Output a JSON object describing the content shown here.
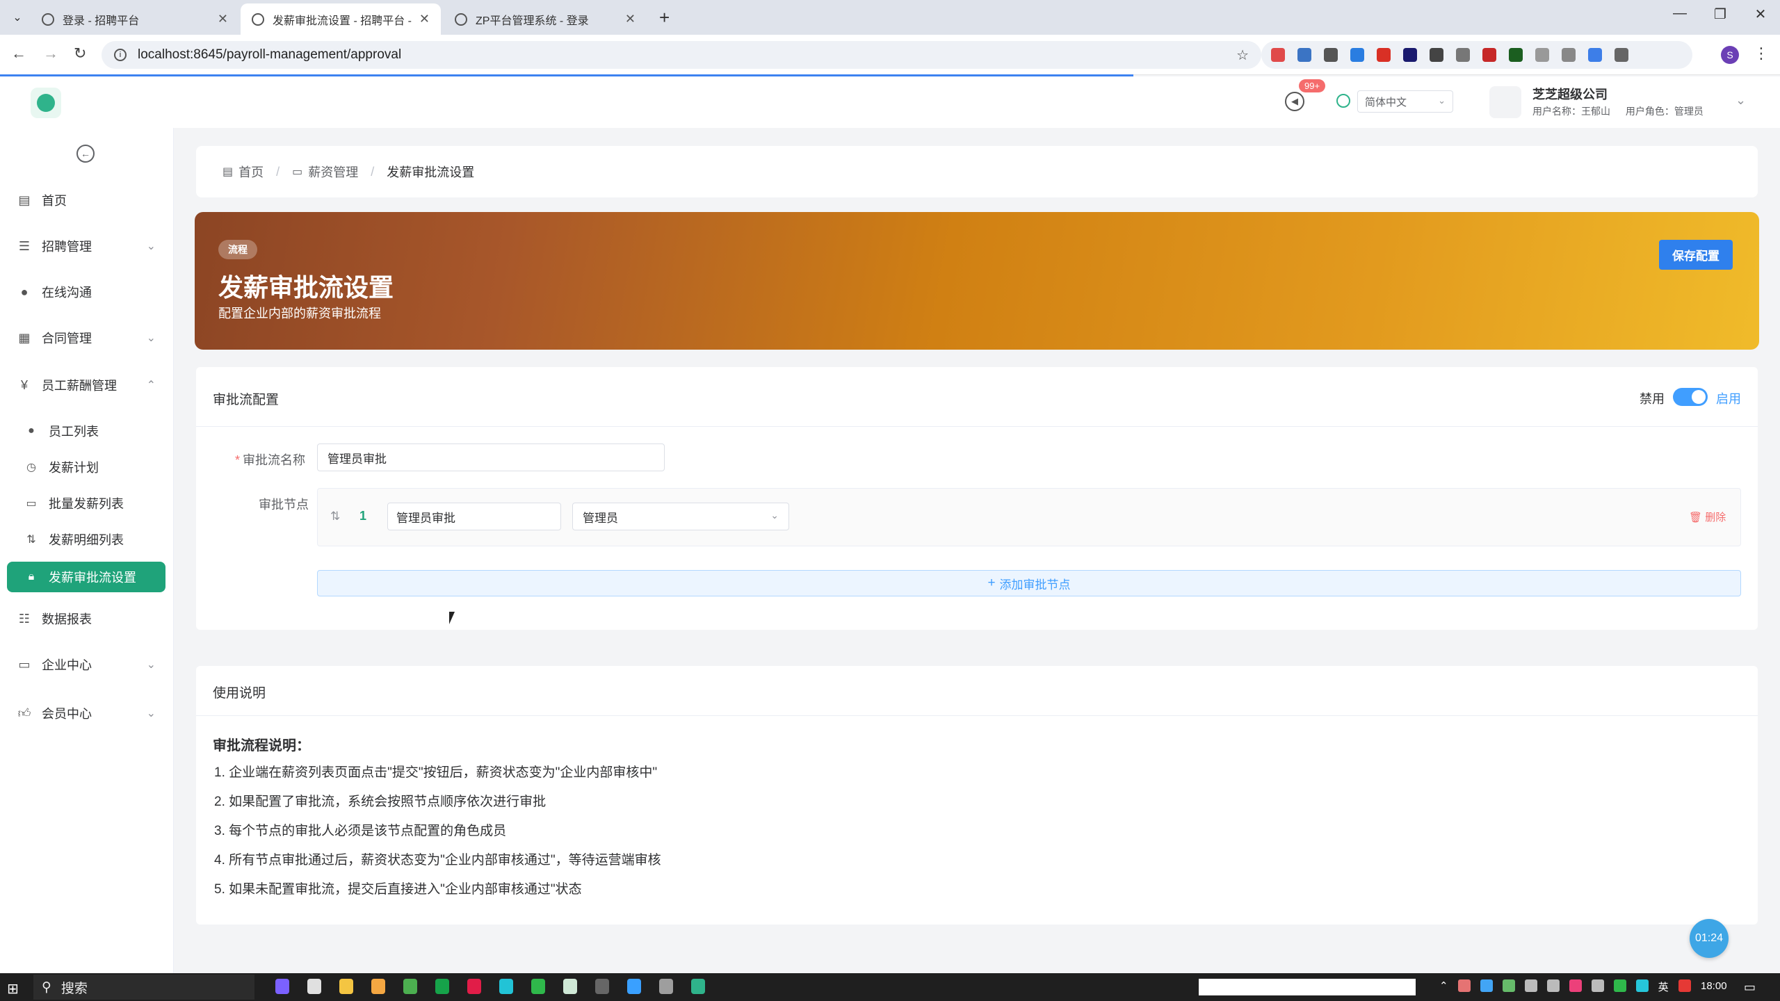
{
  "browser": {
    "tabs": [
      {
        "title": "登录 - 招聘平台",
        "active": false
      },
      {
        "title": "发薪审批流设置 - 招聘平台 - 企",
        "active": true
      },
      {
        "title": "ZP平台管理系统 - 登录",
        "active": false
      }
    ],
    "url": "localhost:8645/payroll-management/approval",
    "profile_initial": "S"
  },
  "header": {
    "notification_badge": "99+",
    "language": "简体中文",
    "company_name": "芝芝超级公司",
    "username_label": "用户名称：王郁山",
    "role_label": "用户角色：管理员"
  },
  "sidebar": {
    "items": [
      {
        "label": "首页",
        "icon": "home-doc-icon"
      },
      {
        "label": "招聘管理",
        "icon": "recruit-icon",
        "expandable": true
      },
      {
        "label": "在线沟通",
        "icon": "chat-icon"
      },
      {
        "label": "合同管理",
        "icon": "contract-icon",
        "expandable": true
      },
      {
        "label": "员工薪酬管理",
        "icon": "yen-icon",
        "expanded": true
      }
    ],
    "sub_items": [
      {
        "label": "员工列表",
        "icon": "user-icon"
      },
      {
        "label": "发薪计划",
        "icon": "clock-icon"
      },
      {
        "label": "批量发薪列表",
        "icon": "batch-icon"
      },
      {
        "label": "发薪明细列表",
        "icon": "sort-icon"
      },
      {
        "label": "发薪审批流设置",
        "icon": "lock-icon",
        "active": true
      }
    ],
    "bottom_items": [
      {
        "label": "数据报表",
        "icon": "report-icon"
      },
      {
        "label": "企业中心",
        "icon": "enterprise-icon",
        "expandable": true
      },
      {
        "label": "会员中心",
        "icon": "thumb-icon",
        "expandable": true
      }
    ]
  },
  "breadcrumb": [
    "首页",
    "薪资管理",
    "发薪审批流设置"
  ],
  "banner": {
    "tag": "流程",
    "title": "发薪审批流设置",
    "subtitle": "配置企业内部的薪资审批流程",
    "save_label": "保存配置",
    "gradient_colors": [
      "#8c4524",
      "#d08013",
      "#f0bb2a"
    ]
  },
  "config": {
    "title": "审批流配置",
    "switch_off_label": "禁用",
    "switch_on_label": "启用",
    "enabled": true,
    "name_label": "审批流名称",
    "name_value": "管理员审批",
    "nodes_label": "审批节点",
    "nodes": [
      {
        "index": "1",
        "name": "管理员审批",
        "role": "管理员"
      }
    ],
    "delete_label": "删除",
    "add_node_label": "添加审批节点"
  },
  "usage": {
    "title": "使用说明",
    "heading": "审批流程说明：",
    "lines": [
      "1. 企业端在薪资列表页面点击\"提交\"按钮后，薪资状态变为\"企业内部审核中\"",
      "2. 如果配置了审批流，系统会按照节点顺序依次进行审批",
      "3. 每个节点的审批人必须是该节点配置的角色成员",
      "4. 所有节点审批通过后，薪资状态变为\"企业内部审核通过\"，等待运营端审核",
      "5. 如果未配置审批流，提交后直接进入\"企业内部审核通过\"状态"
    ]
  },
  "timer": "01:24",
  "taskbar": {
    "search_label": "搜索",
    "ime": "英",
    "clock": "18:00"
  },
  "colors": {
    "accent_green": "#1fa37a",
    "primary_blue": "#409eff",
    "danger_red": "#f56c6c"
  }
}
